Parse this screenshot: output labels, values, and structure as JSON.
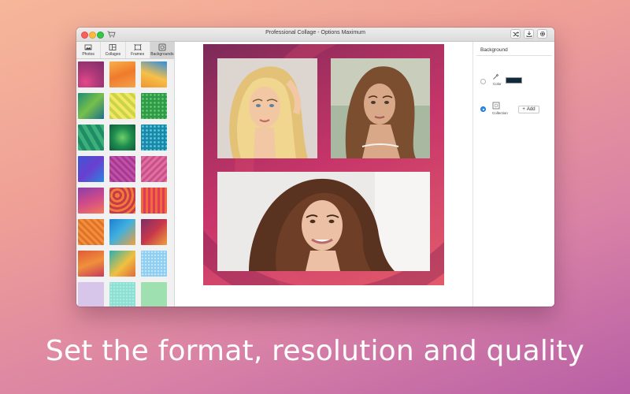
{
  "window": {
    "title": "Professional Collage - Options Maximum"
  },
  "titlebar_buttons": {
    "shuffle": "shuffle-icon",
    "export": "download-icon",
    "settings": "gear-icon",
    "cart": "cart-icon"
  },
  "sidebar": {
    "tabs": [
      {
        "label": "Photos",
        "icon": "photos-icon",
        "active": false
      },
      {
        "label": "Collages",
        "icon": "collages-icon",
        "active": false
      },
      {
        "label": "Frames",
        "icon": "frames-icon",
        "active": false
      },
      {
        "label": "Backgrounds",
        "icon": "backgrounds-icon",
        "active": true
      }
    ]
  },
  "right_panel": {
    "title": "Background",
    "options": [
      {
        "label": "Color",
        "selected": false,
        "color_value": "#0f2a3d"
      },
      {
        "label": "Collection",
        "selected": true
      }
    ],
    "add_label": "Add"
  },
  "caption": "Set the format, resolution and quality"
}
